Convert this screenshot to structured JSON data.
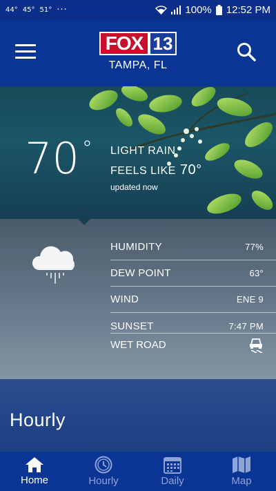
{
  "status_bar": {
    "temps": [
      "44°",
      "45°",
      "51°"
    ],
    "more": "···",
    "battery": "100%",
    "time": "12:52 PM"
  },
  "header": {
    "logo_fox": "FOX",
    "logo_num": "13",
    "city": "TAMPA, FL"
  },
  "current": {
    "temp": "70",
    "deg": "°",
    "condition": "LIGHT RAIN",
    "feels_label": "FEELS LIKE",
    "feels_value": "70°",
    "updated": "updated now"
  },
  "details": [
    {
      "label": "HUMIDITY",
      "value": "77%"
    },
    {
      "label": "DEW POINT",
      "value": "63°"
    },
    {
      "label": "WIND",
      "value": "ENE 9"
    },
    {
      "label": "SUNSET",
      "value": "7:47 PM"
    }
  ],
  "wet_road": {
    "label": "WET ROAD",
    "icon": "slippery-road-icon"
  },
  "hourly": {
    "title": "Hourly"
  },
  "nav": [
    {
      "label": "Home",
      "icon": "home-icon",
      "active": true
    },
    {
      "label": "Hourly",
      "icon": "clock-icon",
      "active": false
    },
    {
      "label": "Daily",
      "icon": "calendar-icon",
      "active": false
    },
    {
      "label": "Map",
      "icon": "map-icon",
      "active": false
    }
  ],
  "colors": {
    "header": "#0b3594",
    "active_tab": "#ffffff",
    "inactive_tab": "#8fa4d4"
  }
}
